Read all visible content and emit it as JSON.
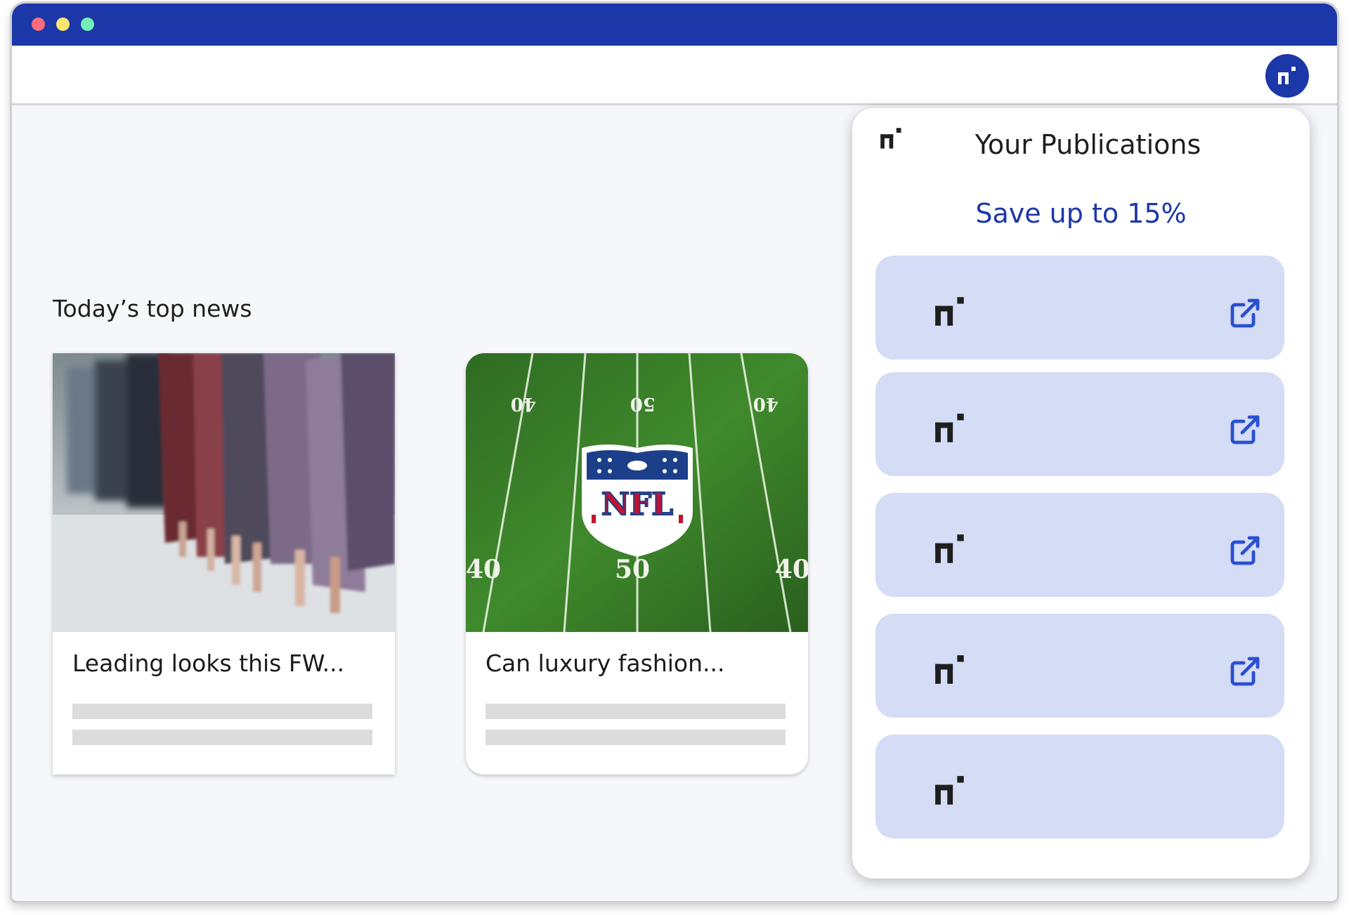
{
  "browser": {
    "controls": [
      "close",
      "minimize",
      "maximize"
    ],
    "title_bar_color": "#1c37a8",
    "extension_icon": "publication-logo-icon"
  },
  "main": {
    "section_title": "Today’s top news",
    "articles": [
      {
        "title": "Leading looks this FW...",
        "image": "runway-fashion-photo"
      },
      {
        "title": "Can luxury fashion...",
        "image": "nfl-field-photo"
      }
    ]
  },
  "popup": {
    "title": "Your Publications",
    "promo": "Save up to 15%",
    "promo_color": "#1c37a8",
    "publications": [
      {
        "logo": "publication-logo-icon",
        "link_icon": "external-link-icon"
      },
      {
        "logo": "publication-logo-icon",
        "link_icon": "external-link-icon"
      },
      {
        "logo": "publication-logo-icon",
        "link_icon": "external-link-icon"
      },
      {
        "logo": "publication-logo-icon",
        "link_icon": "external-link-icon"
      },
      {
        "logo": "publication-logo-icon",
        "link_icon": ""
      }
    ]
  },
  "field_markings": {
    "top_numbers": [
      "40",
      "50",
      "40"
    ],
    "bottom_numbers": [
      "40",
      "50",
      "40"
    ],
    "shield_text": "NFL"
  }
}
